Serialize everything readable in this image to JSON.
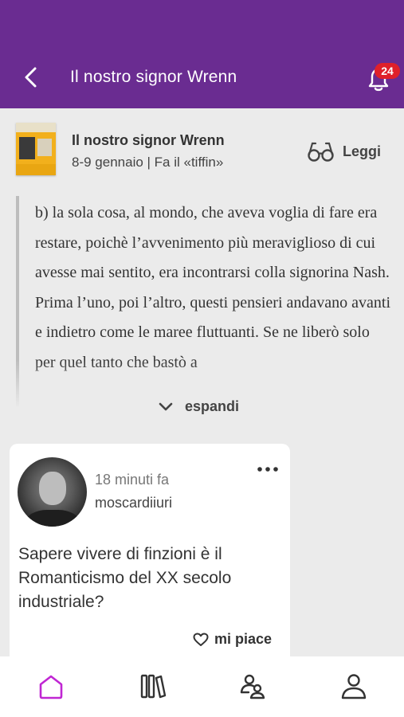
{
  "header": {
    "title": "Il nostro signor Wrenn",
    "notifications_count": "24",
    "background_color": "#6a2c91",
    "badge_color": "#e0202a"
  },
  "book": {
    "title": "Il nostro signor Wrenn",
    "subtitle": "8-9 gennaio | Fa il «tiffin»",
    "read_label": "Leggi"
  },
  "excerpt": {
    "text": "b) la sola cosa, al mondo, che aveva voglia di fare era restare, poichè l’avvenimento più meraviglioso di cui avesse mai sentito, era incontrarsi colla signorina Nash. Prima l’uno, poi l’altro, questi pensieri andavano avanti e indietro come le maree fluttuanti. Se ne liberò solo per quel tanto che bastò a",
    "expand_label": "espandi"
  },
  "post": {
    "time": "18 minuti fa",
    "username": "moscardiiuri",
    "text": "Sapere vivere di finzioni è il Romanticismo del XX secolo industriale?",
    "like_label": "mi piace"
  },
  "tabbar": {
    "items": [
      {
        "icon": "home-icon",
        "active": true
      },
      {
        "icon": "library-icon",
        "active": false
      },
      {
        "icon": "community-icon",
        "active": false
      },
      {
        "icon": "profile-icon",
        "active": false
      }
    ],
    "active_color": "#c026d3",
    "inactive_color": "#333333"
  }
}
